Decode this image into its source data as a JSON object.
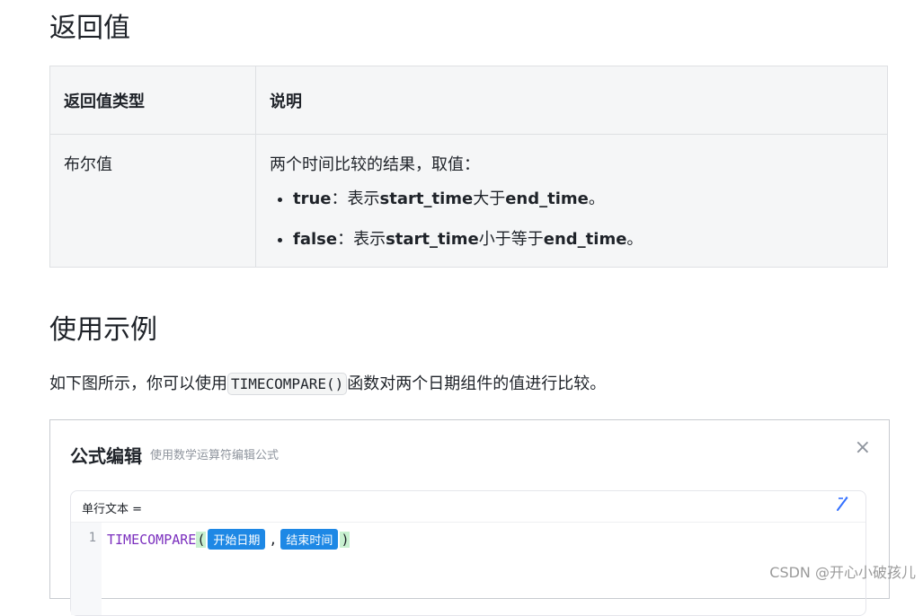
{
  "section_return": {
    "title": "返回值",
    "table": {
      "headers": [
        "返回值类型",
        "说明"
      ],
      "row": {
        "type": "布尔值",
        "desc": "两个时间比较的结果，取值：",
        "items": [
          {
            "key": "true",
            "sep": "：表示",
            "a": "start_time",
            "mid": "大于",
            "b": "end_time",
            "end": "。"
          },
          {
            "key": "false",
            "sep": "：表示",
            "a": "start_time",
            "mid": "小于等于",
            "b": "end_time",
            "end": "。"
          }
        ]
      }
    }
  },
  "section_example": {
    "title": "使用示例",
    "para_before": "如下图所示，你可以使用",
    "code": "TIMECOMPARE()",
    "para_after": "函数对两个日期组件的值进行比较。"
  },
  "dialog": {
    "title": "公式编辑",
    "subtitle": "使用数学运算符编辑公式",
    "close_icon": "×",
    "field_label": "单行文本 =",
    "magic_icon": "⁄̷",
    "line_number": "1",
    "func": "TIMECOMPARE",
    "open_paren": "(",
    "arg1": "开始日期",
    "comma": ",",
    "arg2": "结束时间",
    "close_paren": ")"
  },
  "watermark": "CSDN @开心小破孩儿"
}
